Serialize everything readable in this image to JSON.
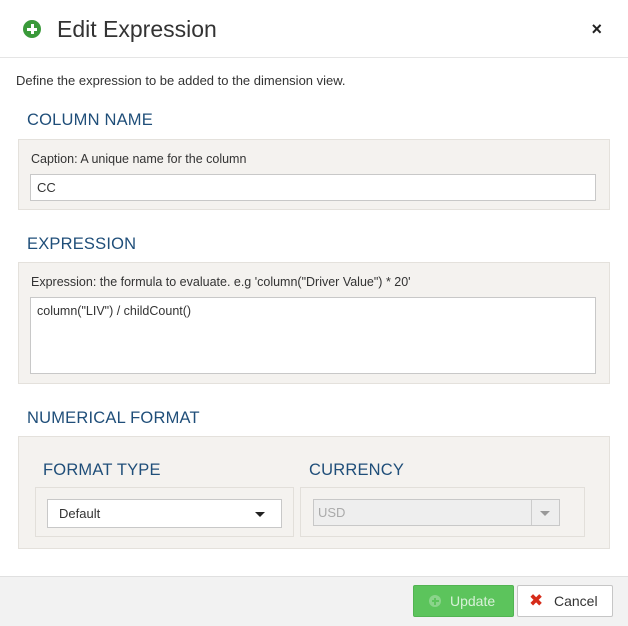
{
  "header": {
    "title": "Edit Expression",
    "close_icon": "×"
  },
  "description": "Define the expression to be added to the dimension view.",
  "column_name": {
    "section_title": "COLUMN NAME",
    "label": "Caption: A unique name for the column",
    "value": "CC"
  },
  "expression": {
    "section_title": "EXPRESSION",
    "label": "Expression: the formula to evaluate. e.g 'column(\"Driver Value\") * 20'",
    "value": "column(\"LIV\") / childCount()"
  },
  "numerical_format": {
    "section_title": "NUMERICAL FORMAT",
    "format_type": {
      "label": "FORMAT TYPE",
      "selected": "Default"
    },
    "currency": {
      "label": "CURRENCY",
      "selected": "USD",
      "disabled": true
    }
  },
  "footer": {
    "update_label": "Update",
    "cancel_label": "Cancel",
    "cancel_icon": "✖"
  },
  "colors": {
    "section_title": "#1f4e79",
    "update_button": "#5cc45c",
    "cancel_icon": "#d62c1a",
    "header_icon": "#3a9a3a"
  }
}
